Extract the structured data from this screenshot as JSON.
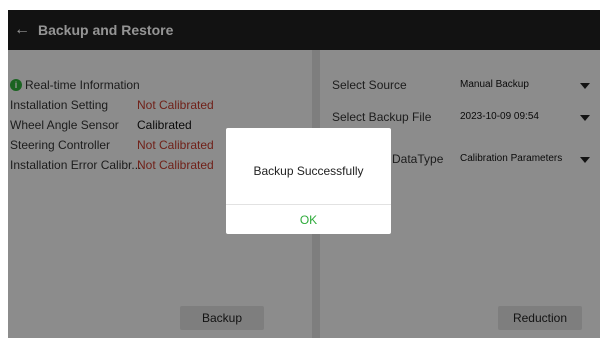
{
  "header": {
    "back_icon": "arrow-left-icon",
    "title": "Backup and Restore"
  },
  "left_panel": {
    "section_title": "Real-time Information",
    "section_icon": "info-icon",
    "rows": [
      {
        "label": "Installation Setting",
        "value": "Not Calibrated",
        "status": "red"
      },
      {
        "label": "Wheel Angle Sensor",
        "value": "Calibrated",
        "status": "black"
      },
      {
        "label": "Steering Controller",
        "value": "Not Calibrated",
        "status": "red"
      },
      {
        "label": "Installation Error Calibr...",
        "value": "Not Calibrated",
        "status": "red"
      }
    ],
    "backup_button": "Backup"
  },
  "right_panel": {
    "selectors": [
      {
        "label": "Select Source",
        "value": "Manual Backup"
      },
      {
        "label": "Select Backup File",
        "value": "2023-10-09 09:54"
      },
      {
        "label": "DataType",
        "value": "Calibration Parameters"
      }
    ],
    "reduction_button": "Reduction"
  },
  "dialog": {
    "message": "Backup Successfully",
    "ok_label": "OK"
  },
  "colors": {
    "accent_green": "#2eab3a",
    "status_red": "#c0392b"
  }
}
